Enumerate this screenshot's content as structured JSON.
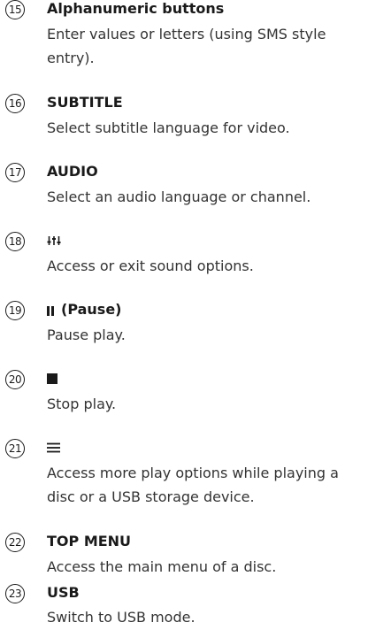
{
  "items": [
    {
      "number": "15",
      "title": "Alphanumeric buttons",
      "lines": [
        "Enter values or letters (using SMS style",
        "entry)."
      ]
    },
    {
      "number": "16",
      "title": "SUBTITLE",
      "lines": [
        "Select subtitle language for video."
      ]
    },
    {
      "number": "17",
      "title": "AUDIO",
      "lines": [
        "Select an audio language or channel."
      ]
    },
    {
      "number": "18",
      "icon": "sound-settings-icon",
      "lines": [
        "Access or exit sound options."
      ]
    },
    {
      "number": "19",
      "icon": "pause-icon",
      "title": "(Pause)",
      "lines": [
        "Pause play."
      ]
    },
    {
      "number": "20",
      "icon": "stop-icon",
      "lines": [
        "Stop play."
      ]
    },
    {
      "number": "21",
      "icon": "options-menu-icon",
      "lines": [
        "Access more play options while playing a",
        "disc or a USB storage device."
      ]
    },
    {
      "number": "22",
      "title": "TOP MENU",
      "lines": [
        "Access the main menu of a disc."
      ]
    },
    {
      "number": "23",
      "title": "USB",
      "lines": [
        "Switch to USB mode."
      ]
    }
  ]
}
